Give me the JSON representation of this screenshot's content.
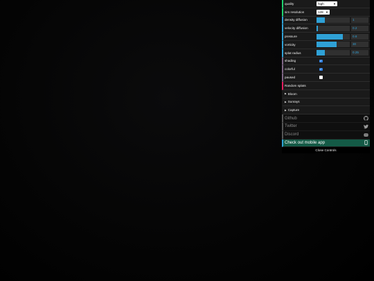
{
  "controls": {
    "quality": {
      "label": "quality",
      "value": "high"
    },
    "sim_resolution": {
      "label": "sim resolution",
      "value": "128"
    },
    "sliders": [
      {
        "name": "density-diffusion",
        "label": "density diffusion",
        "value": "1",
        "fraction": 0.25
      },
      {
        "name": "velocity-diffusion",
        "label": "velocity diffusion",
        "value": "0.2",
        "fraction": 0.05
      },
      {
        "name": "pressure",
        "label": "pressure",
        "value": "0.8",
        "fraction": 0.8
      },
      {
        "name": "vorticity",
        "label": "vorticity",
        "value": "30",
        "fraction": 0.6
      },
      {
        "name": "splat-radius",
        "label": "splat radius",
        "value": "0.25",
        "fraction": 0.25
      }
    ],
    "toggles": [
      {
        "name": "shading",
        "label": "shading",
        "checked": true
      },
      {
        "name": "colorful",
        "label": "colorful",
        "checked": true
      },
      {
        "name": "paused",
        "label": "paused",
        "checked": false
      }
    ],
    "random_splats": "Random splats"
  },
  "folders": [
    "Bloom",
    "Sunrays",
    "Capture"
  ],
  "links": [
    {
      "name": "github",
      "label": "Github",
      "icon": "github-icon"
    },
    {
      "name": "twitter",
      "label": "Twitter",
      "icon": "twitter-icon"
    },
    {
      "name": "discord",
      "label": "Discord",
      "icon": "discord-icon"
    },
    {
      "name": "mobile-app",
      "label": "Check out mobile app",
      "icon": "phone-icon"
    }
  ],
  "close_label": "Close Controls",
  "colors": {
    "accent": "#2fa1d6",
    "panel": "#1a1a1a",
    "app_link": "#145a46"
  }
}
